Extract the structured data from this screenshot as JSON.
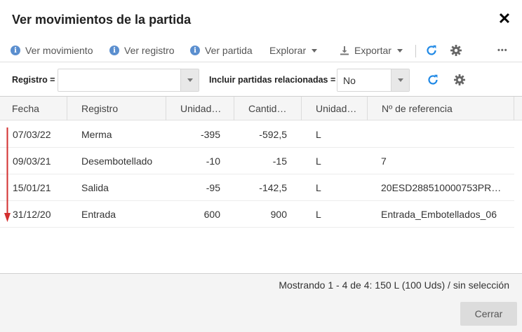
{
  "dialog": {
    "title": "Ver movimientos de la partida",
    "close_glyph": "✕"
  },
  "toolbar": {
    "ver_movimiento": "Ver movimiento",
    "ver_registro": "Ver registro",
    "ver_partida": "Ver partida",
    "explorar": "Explorar",
    "exportar": "Exportar",
    "more": "•••",
    "accent_color": "#1e88e5"
  },
  "filters": {
    "registro_label": "Registro =",
    "registro_value": "",
    "incluir_label": "Incluir partidas relacionadas =",
    "incluir_value": "No"
  },
  "grid": {
    "columns": [
      "Fecha",
      "Registro",
      "Unidad…",
      "Cantid…",
      "Unidad…",
      "Nº de referencia"
    ],
    "rows": [
      {
        "fecha": "07/03/22",
        "registro": "Merma",
        "unidades": "-395",
        "cantidad": "-592,5",
        "unidad": "L",
        "referencia": ""
      },
      {
        "fecha": "09/03/21",
        "registro": "Desembotellado",
        "unidades": "-10",
        "cantidad": "-15",
        "unidad": "L",
        "referencia": "7"
      },
      {
        "fecha": "15/01/21",
        "registro": "Salida",
        "unidades": "-95",
        "cantidad": "-142,5",
        "unidad": "L",
        "referencia": "20ESD288510000753PR…"
      },
      {
        "fecha": "31/12/20",
        "registro": "Entrada",
        "unidades": "600",
        "cantidad": "900",
        "unidad": "L",
        "referencia": "Entrada_Embotellados_06"
      }
    ],
    "sort_arrow_color": "#d32f2f"
  },
  "footer": {
    "status": "Mostrando 1 - 4 de 4: 150 L (100 Uds) / sin selección",
    "close_button": "Cerrar"
  }
}
